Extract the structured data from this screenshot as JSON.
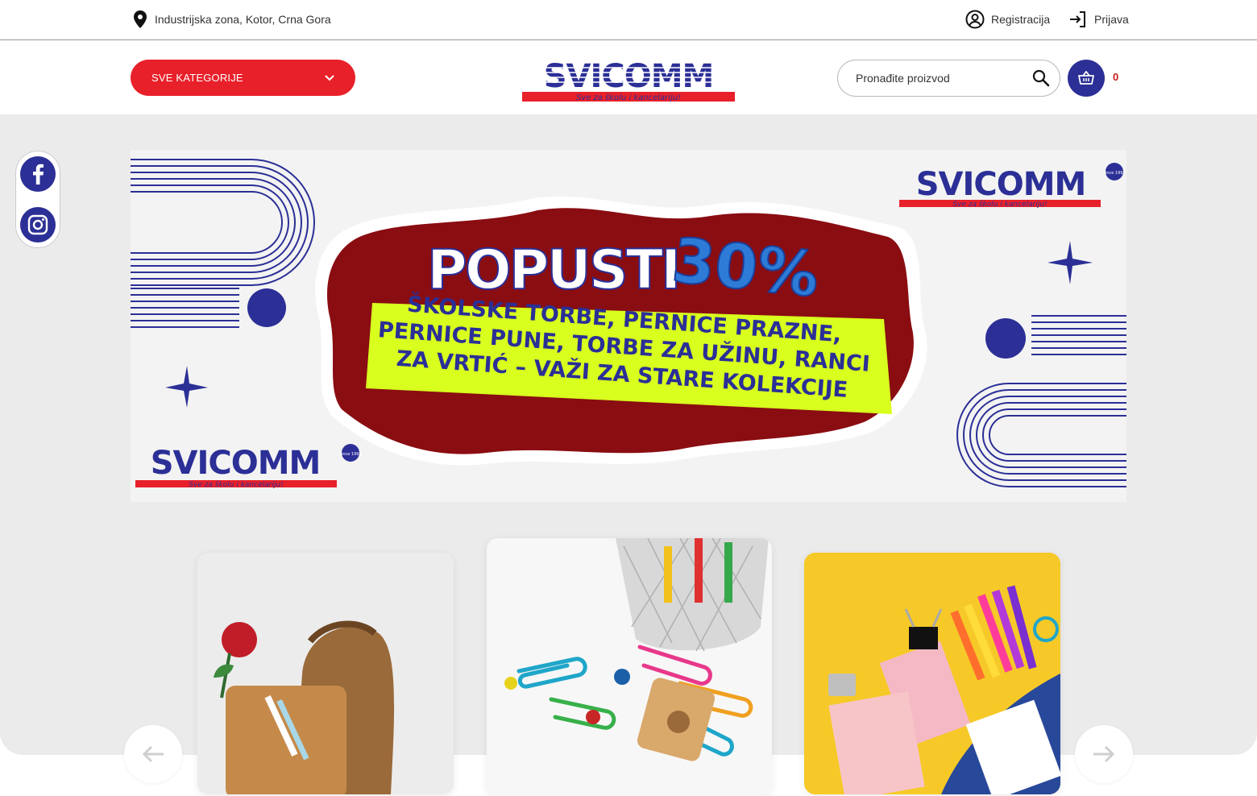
{
  "topbar": {
    "location": "Industrijska zona, Kotor, Crna Gora",
    "register_label": "Registracija",
    "login_label": "Prijava"
  },
  "header": {
    "categories_label": "SVE KATEGORIJE",
    "logo_text": "SVICOMM",
    "logo_tagline": "Sve za školu i kancelariju!",
    "search_placeholder": "Pronađite proizvod",
    "cart_count": "0"
  },
  "social": {
    "items": [
      "facebook-icon",
      "instagram-icon"
    ]
  },
  "banner": {
    "headline": "POPUSTI",
    "discount": "30%",
    "lines": [
      "ŠKOLSKE TORBE, PERNICE PRAZNE,",
      "PERNICE PUNE, TORBE ZA UŽINU, RANCI",
      "ZA VRTIĆ – VAŽI ZA STARE KOLEKCIJE"
    ],
    "logo_text": "SVICOMM",
    "logo_tagline": "Sve za školu i kancelariju!",
    "since_label": "since 1993"
  },
  "colors": {
    "brand_blue": "#2b2f96",
    "brand_red": "#e8202a",
    "banner_dark_red": "#8a0d12",
    "lime": "#d8ff1e"
  }
}
